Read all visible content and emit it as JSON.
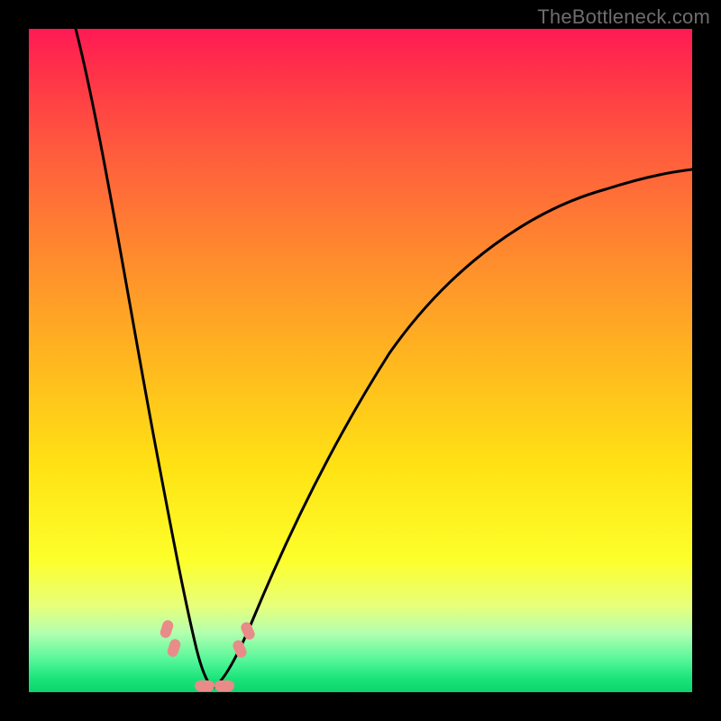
{
  "watermark": "TheBottleneck.com",
  "colors": {
    "frame": "#000000",
    "gradient_top": "#ff1a55",
    "gradient_mid": "#ffe214",
    "gradient_bottom": "#0ed36d",
    "curve": "#000000",
    "points": "#e98b88"
  },
  "chart_data": {
    "type": "line",
    "title": "",
    "xlabel": "",
    "ylabel": "",
    "xlim": [
      0,
      100
    ],
    "ylim": [
      0,
      100
    ],
    "grid": false,
    "legend": false,
    "annotations": [
      "TheBottleneck.com"
    ],
    "note": "Two monotone curves forming a V; minimum (valley) near x≈25, y≈0. No numeric axis ticks are visible, so values are normalized 0–100 estimates from pixel position.",
    "series": [
      {
        "name": "left-branch",
        "x": [
          7,
          10,
          13,
          16,
          19,
          21,
          23,
          25,
          27
        ],
        "y": [
          100,
          80,
          58,
          38,
          22,
          12,
          5,
          1,
          0
        ]
      },
      {
        "name": "right-branch",
        "x": [
          27,
          30,
          34,
          40,
          48,
          58,
          70,
          84,
          100
        ],
        "y": [
          0,
          4,
          11,
          22,
          36,
          50,
          62,
          71,
          78
        ]
      }
    ],
    "points": [
      {
        "x": 20.5,
        "y": 8.5,
        "label": "left-cluster-top"
      },
      {
        "x": 21.5,
        "y": 6.0,
        "label": "left-cluster-bottom"
      },
      {
        "x": 26.0,
        "y": 0.6,
        "label": "valley-left"
      },
      {
        "x": 28.5,
        "y": 0.6,
        "label": "valley-right"
      },
      {
        "x": 31.5,
        "y": 6.0,
        "label": "right-cluster-bottom"
      },
      {
        "x": 32.5,
        "y": 8.5,
        "label": "right-cluster-top"
      }
    ]
  }
}
